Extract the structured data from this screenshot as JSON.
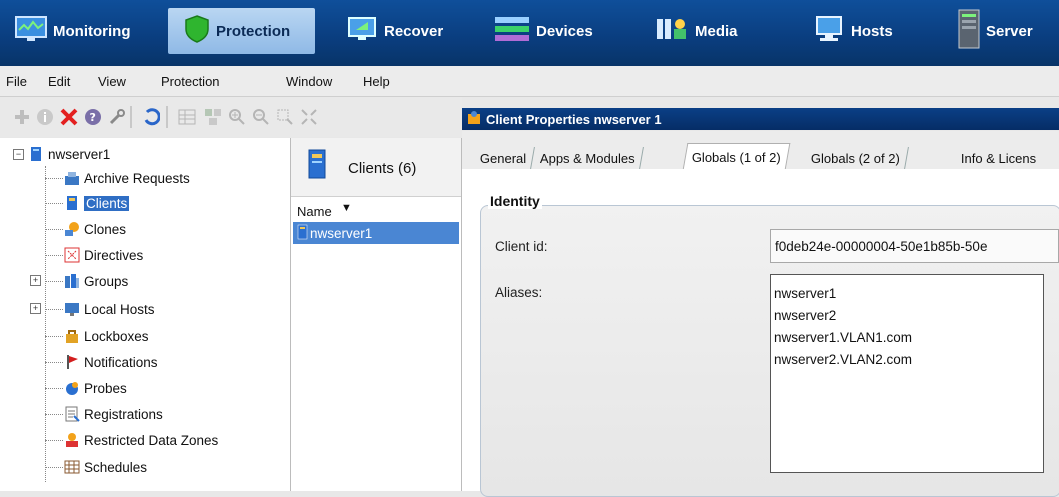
{
  "topnav": {
    "items": [
      {
        "label": "Monitoring",
        "icon": "monitor-icon"
      },
      {
        "label": "Protection",
        "icon": "shield-icon",
        "active": true
      },
      {
        "label": "Recover",
        "icon": "recover-icon"
      },
      {
        "label": "Devices",
        "icon": "devices-icon"
      },
      {
        "label": "Media",
        "icon": "media-icon"
      },
      {
        "label": "Hosts",
        "icon": "hosts-icon"
      },
      {
        "label": "Server",
        "icon": "server-icon"
      }
    ]
  },
  "menubar": {
    "items": [
      "File",
      "Edit",
      "View",
      "Protection",
      "Window",
      "Help"
    ]
  },
  "properties": {
    "title": "Client Properties nwserver 1",
    "tabs": [
      "General",
      "Apps & Modules",
      "Globals (1 of 2)",
      "Globals (2 of 2)",
      "Info & Licens"
    ],
    "active_tab": "Globals (1 of 2)",
    "group_title": "Identity",
    "client_id_label": "Client id:",
    "client_id_value": "f0deb24e-00000004-50e1b85b-50e",
    "aliases_label": "Aliases:",
    "aliases": [
      "nwserver1",
      "nwserver2",
      "nwserver1.VLAN1.com",
      "nwserver2.VLAN2.com"
    ]
  },
  "tree": {
    "root": "nwserver1",
    "items": [
      {
        "label": "Archive Requests",
        "icon": "archive-requests-icon"
      },
      {
        "label": "Clients",
        "icon": "clients-icon",
        "selected": true
      },
      {
        "label": "Clones",
        "icon": "clones-icon"
      },
      {
        "label": "Directives",
        "icon": "directives-icon"
      },
      {
        "label": "Groups",
        "icon": "groups-icon",
        "expandable": true
      },
      {
        "label": "Local Hosts",
        "icon": "local-hosts-icon",
        "expandable": true
      },
      {
        "label": "Lockboxes",
        "icon": "lockboxes-icon"
      },
      {
        "label": "Notifications",
        "icon": "notifications-icon"
      },
      {
        "label": "Probes",
        "icon": "probes-icon"
      },
      {
        "label": "Registrations",
        "icon": "registrations-icon"
      },
      {
        "label": "Restricted Data Zones",
        "icon": "restricted-data-zones-icon"
      },
      {
        "label": "Schedules",
        "icon": "schedules-icon"
      }
    ]
  },
  "clients": {
    "title": "Clients (6)",
    "column_name": "Name",
    "rows": [
      "nwserver1"
    ]
  }
}
